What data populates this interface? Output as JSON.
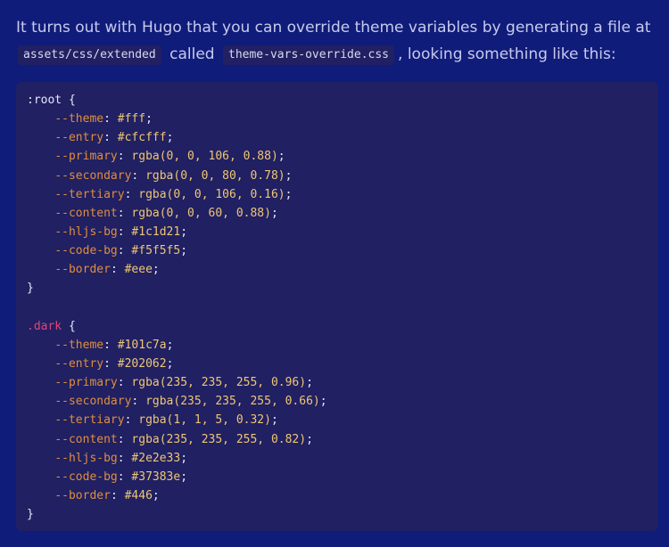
{
  "paragraph": {
    "part1": "It turns out with Hugo that you can override theme variables by generating a file at",
    "code1": "assets/css/extended",
    "part2": "called",
    "code2": "theme-vars-override.css",
    "part3": ", looking something like this:"
  },
  "code": {
    "blocks": [
      {
        "selector": ":root",
        "is_dark": false,
        "declarations": [
          {
            "prop": "--theme",
            "value": "#fff"
          },
          {
            "prop": "--entry",
            "value": "#cfcfff"
          },
          {
            "prop": "--primary",
            "value": "rgba(0, 0, 106, 0.88)"
          },
          {
            "prop": "--secondary",
            "value": "rgba(0, 0, 80, 0.78)"
          },
          {
            "prop": "--tertiary",
            "value": "rgba(0, 0, 106, 0.16)"
          },
          {
            "prop": "--content",
            "value": "rgba(0, 0, 60, 0.88)"
          },
          {
            "prop": "--hljs-bg",
            "value": "#1c1d21"
          },
          {
            "prop": "--code-bg",
            "value": "#f5f5f5"
          },
          {
            "prop": "--border",
            "value": "#eee"
          }
        ]
      },
      {
        "selector": ".dark",
        "is_dark": true,
        "declarations": [
          {
            "prop": "--theme",
            "value": "#101c7a"
          },
          {
            "prop": "--entry",
            "value": "#202062"
          },
          {
            "prop": "--primary",
            "value": "rgba(235, 235, 255, 0.96)"
          },
          {
            "prop": "--secondary",
            "value": "rgba(235, 235, 255, 0.66)"
          },
          {
            "prop": "--tertiary",
            "value": "rgba(1, 1, 5, 0.32)"
          },
          {
            "prop": "--content",
            "value": "rgba(235, 235, 255, 0.82)"
          },
          {
            "prop": "--hljs-bg",
            "value": "#2e2e33"
          },
          {
            "prop": "--code-bg",
            "value": "#37383e"
          },
          {
            "prop": "--border",
            "value": "#446"
          }
        ]
      }
    ]
  }
}
